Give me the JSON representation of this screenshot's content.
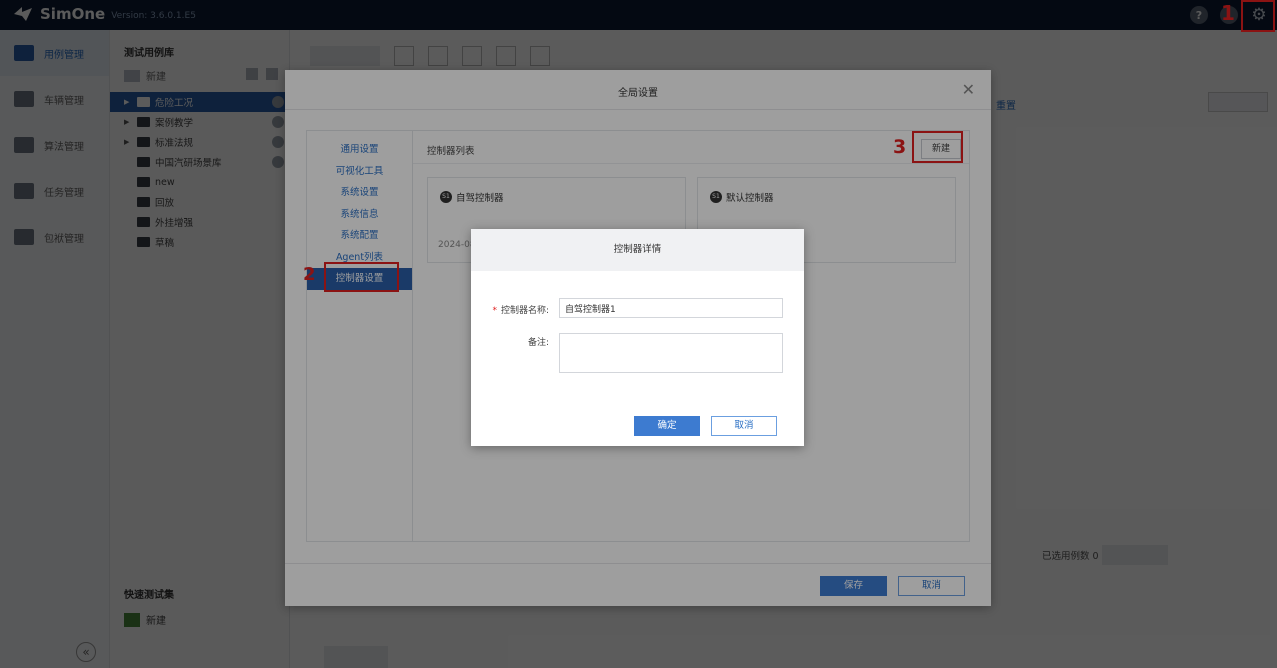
{
  "app": {
    "name": "SimOne",
    "version": "Version: 3.6.0.1.E5"
  },
  "topbar": {
    "help_glyph": "?",
    "bell_glyph": "!"
  },
  "leftnav": {
    "items": [
      {
        "label": "用例管理",
        "icon": "folder-icon"
      },
      {
        "label": "车辆管理",
        "icon": "car-icon"
      },
      {
        "label": "算法管理",
        "icon": "code-icon"
      },
      {
        "label": "任务管理",
        "icon": "task-icon"
      },
      {
        "label": "包袱管理",
        "icon": "package-icon"
      }
    ],
    "collapse_glyph": "«"
  },
  "tree": {
    "title": "测试用例库",
    "new_label": "新建",
    "items": [
      {
        "label": "危险工况",
        "caret": "▶",
        "selected": true
      },
      {
        "label": "案例教学",
        "caret": "▶",
        "selected": false
      },
      {
        "label": "标准法规",
        "caret": "▶",
        "selected": false
      },
      {
        "label": "中国汽研场景库",
        "caret": "",
        "selected": false
      },
      {
        "label": "new",
        "caret": "",
        "selected": false
      },
      {
        "label": "回放",
        "caret": "",
        "selected": false
      },
      {
        "label": "外挂增强",
        "caret": "",
        "selected": false
      },
      {
        "label": "草稿",
        "caret": "",
        "selected": false
      }
    ],
    "quick_title": "快速测试集",
    "quick_new_label": "新建"
  },
  "main": {
    "link_text": "重置",
    "selected_count": "已选用例数 0"
  },
  "global_settings": {
    "title": "全局设置",
    "close_glyph": "✕",
    "menu": [
      {
        "label": "通用设置"
      },
      {
        "label": "可视化工具"
      },
      {
        "label": "系统设置"
      },
      {
        "label": "系统信息"
      },
      {
        "label": "系统配置"
      },
      {
        "label": "Agent列表"
      },
      {
        "label": "控制器设置"
      }
    ],
    "controller_list_title": "控制器列表",
    "new_button": "新建",
    "cards": [
      {
        "name": "自驾控制器",
        "date": "2024-08",
        "icon_text": "S1"
      },
      {
        "name": "默认控制器",
        "date": "",
        "icon_text": "S1"
      }
    ],
    "save_button": "保存",
    "cancel_button": "取消"
  },
  "controller_dialog": {
    "title": "控制器详情",
    "name_label": "控制器名称:",
    "required_mark": "*",
    "name_value": "自驾控制器1",
    "note_label": "备注:",
    "note_value": "",
    "confirm_button": "确定",
    "cancel_button": "取消"
  },
  "annotations": {
    "step1": "1",
    "step2": "2",
    "step3": "3"
  },
  "colors": {
    "topbar": "#0f1d33",
    "accent": "#2a5ea8",
    "primary_button": "#3d7bd0",
    "annotation": "#e02020"
  }
}
